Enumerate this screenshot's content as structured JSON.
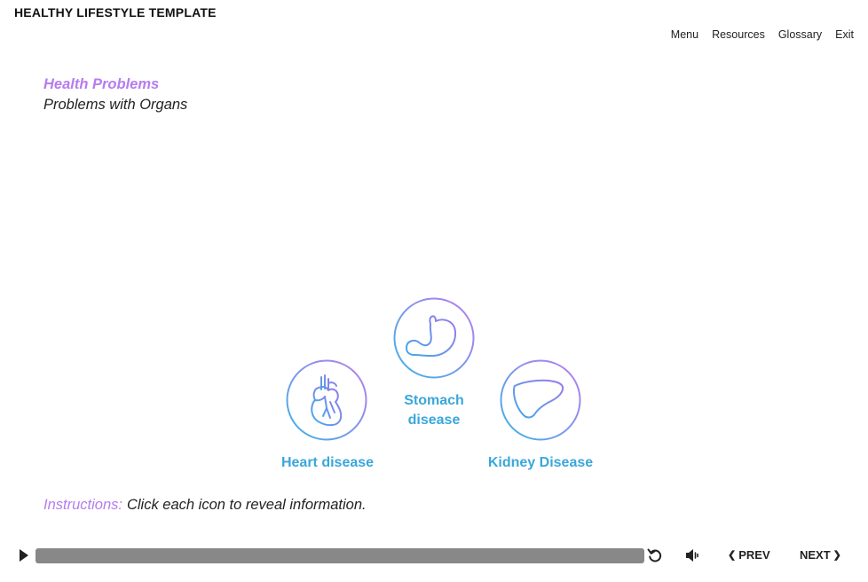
{
  "header": {
    "course_title": "HEALTHY LIFESTYLE TEMPLATE"
  },
  "top_nav": {
    "items": [
      "Menu",
      "Resources",
      "Glossary",
      "Exit"
    ]
  },
  "slide": {
    "section_title": "Health Problems",
    "section_subtitle": "Problems with Organs",
    "organs": [
      {
        "label_line1": "Stomach",
        "label_line2": "disease",
        "icon": "stomach-icon"
      },
      {
        "label": "Heart disease",
        "icon": "heart-icon"
      },
      {
        "label": "Kidney Disease",
        "icon": "kidney-icon"
      }
    ],
    "instructions_lead": "Instructions:",
    "instructions_text": "Click each icon to reveal information."
  },
  "player": {
    "prev_label": "PREV",
    "next_label": "NEXT",
    "progress": 0,
    "icons": [
      "play-icon",
      "replay-icon",
      "volume-icon",
      "chevron-left-icon",
      "chevron-right-icon"
    ]
  },
  "colors": {
    "accent_purple": "#b57cf0",
    "accent_blue": "#3aa7db",
    "progress_track": "#888888"
  }
}
